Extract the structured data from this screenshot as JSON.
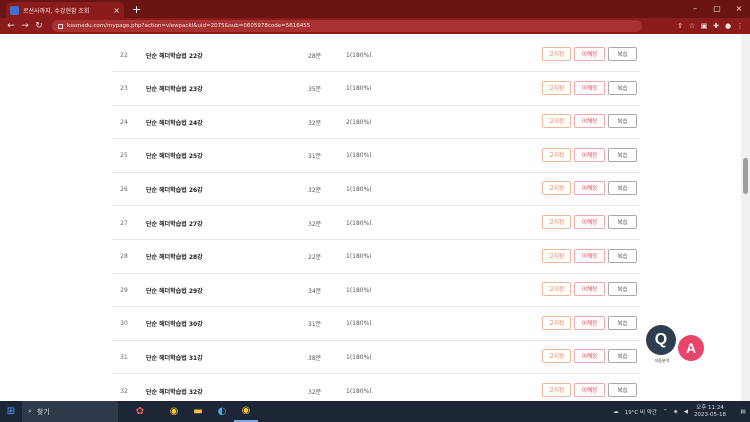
{
  "browser": {
    "tab_title": "르선사까지, 수강현황 조회",
    "tab_close": "×",
    "new_tab": "+",
    "url": "kssmedu.com/mypage.php?action=viewpackl&uid=2075&sub=0605978code=5616455",
    "window_controls": [
      "–",
      "▢",
      "×"
    ],
    "extension_icons": [
      "share-icon",
      "star-icon",
      "ext-icon",
      "puzzle-icon",
      "profile-icon",
      "menu-icon"
    ]
  },
  "lessons": [
    {
      "num": "22",
      "title": "단순 헤더학습법 22강",
      "duration": "28분",
      "count": "1(180%)",
      "btn1": "고지정",
      "btn2": "이해정",
      "btn3": "복습"
    },
    {
      "num": "23",
      "title": "단순 헤더학습법 23강",
      "duration": "35분",
      "count": "1(180%)",
      "btn1": "고지정",
      "btn2": "이해정",
      "btn3": "복습"
    },
    {
      "num": "24",
      "title": "단순 헤더학습법 24강",
      "duration": "32분",
      "count": "2(180%)",
      "btn1": "고지정",
      "btn2": "이해정",
      "btn3": "복습"
    },
    {
      "num": "25",
      "title": "단순 헤더학습법 25강",
      "duration": "31분",
      "count": "1(180%)",
      "btn1": "고지정",
      "btn2": "이해정",
      "btn3": "복습"
    },
    {
      "num": "26",
      "title": "단순 헤더학습법 26강",
      "duration": "32분",
      "count": "1(180%)",
      "btn1": "고지정",
      "btn2": "이해정",
      "btn3": "복습"
    },
    {
      "num": "27",
      "title": "단순 헤더학습법 27강",
      "duration": "32분",
      "count": "1(180%)",
      "btn1": "고지정",
      "btn2": "이해정",
      "btn3": "복습"
    },
    {
      "num": "28",
      "title": "단순 헤더학습법 28강",
      "duration": "22분",
      "count": "1(180%)",
      "btn1": "고지정",
      "btn2": "이해정",
      "btn3": "복습"
    },
    {
      "num": "29",
      "title": "단순 헤더학습법 29강",
      "duration": "34분",
      "count": "1(180%)",
      "btn1": "고지정",
      "btn2": "이해정",
      "btn3": "복습"
    },
    {
      "num": "30",
      "title": "단순 헤더학습법 30강",
      "duration": "31분",
      "count": "1(180%)",
      "btn1": "고지정",
      "btn2": "이해정",
      "btn3": "복습"
    },
    {
      "num": "31",
      "title": "단순 헤더학습법 31강",
      "duration": "38분",
      "count": "1(180%)",
      "btn1": "고지정",
      "btn2": "이해정",
      "btn3": "복습"
    },
    {
      "num": "32",
      "title": "단순 헤더학습법 32강",
      "duration": "32분",
      "count": "1(180%)",
      "btn1": "고지정",
      "btn2": "이해정",
      "btn3": "복습"
    }
  ],
  "qa_widget": {
    "q": "Q",
    "a": "A",
    "caption": "자동분석"
  },
  "taskbar": {
    "search_placeholder": "찾기",
    "weather": "19°C 비 약간",
    "time": "오후 11:24",
    "date": "2023-05-18"
  }
}
